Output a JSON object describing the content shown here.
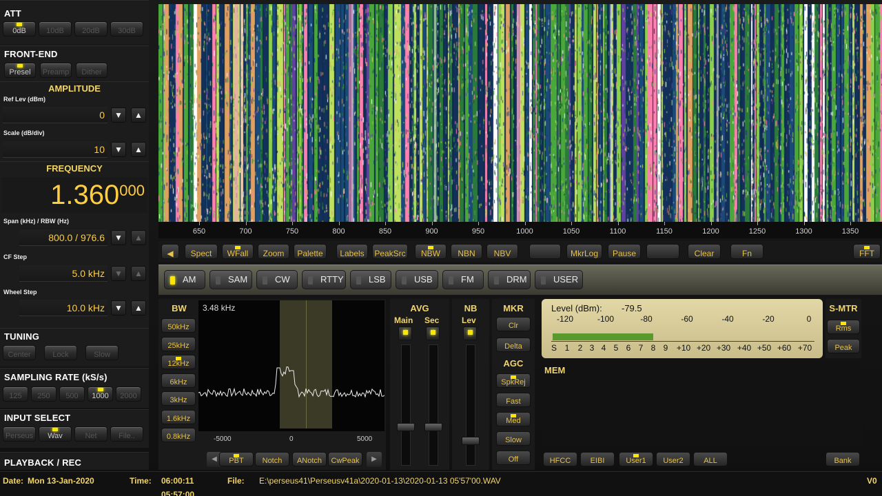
{
  "att": {
    "title": "ATT",
    "buttons": [
      "0dB",
      "10dB",
      "20dB",
      "30dB"
    ],
    "active": 0
  },
  "frontend": {
    "title": "FRONT-END",
    "buttons": [
      "Presel",
      "Preamp",
      "Dither"
    ],
    "active": 0
  },
  "amplitude": {
    "title": "AMPLITUDE",
    "ref_label": "Ref Lev (dBm)",
    "ref_value": "0",
    "scale_label": "Scale (dB/div)",
    "scale_value": "10"
  },
  "frequency": {
    "title": "FREQUENCY",
    "main": "1.360",
    "sub": "000",
    "span_label": "Span (kHz) / RBW (Hz)",
    "span_value": "800.0 / 976.6",
    "cfstep_label": "CF Step",
    "cfstep_value": "5.0 kHz",
    "wheel_label": "Wheel Step",
    "wheel_value": "10.0 kHz"
  },
  "tuning": {
    "title": "TUNING",
    "buttons": [
      "Center",
      "Lock",
      "Slow"
    ]
  },
  "sampling": {
    "title": "SAMPLING RATE (kS/s)",
    "buttons": [
      "125",
      "250",
      "500",
      "1000",
      "2000"
    ],
    "active": 3
  },
  "input": {
    "title": "INPUT SELECT",
    "buttons": [
      "Perseus",
      "Wav",
      "Net",
      "File.."
    ],
    "active": 1
  },
  "playback": {
    "title": "PLAYBACK / REC"
  },
  "freq_axis": [
    "650",
    "700",
    "750",
    "800",
    "850",
    "900",
    "950",
    "1000",
    "1050",
    "1100",
    "1150",
    "1200",
    "1250",
    "1300",
    "1350"
  ],
  "toolbar": {
    "buttons": [
      {
        "label": "◀",
        "led": false
      },
      {
        "label": "Spect",
        "led": false
      },
      {
        "label": "WFall",
        "led": true
      },
      {
        "label": "Zoom",
        "led": false
      },
      {
        "label": "Palette",
        "led": false
      },
      {
        "label": "Labels",
        "led": false
      },
      {
        "label": "PeakSrc",
        "led": false
      },
      {
        "label": "NBW",
        "led": true
      },
      {
        "label": "NBN",
        "led": false
      },
      {
        "label": "NBV",
        "led": false
      },
      {
        "label": "",
        "led": false
      },
      {
        "label": "MkrLog",
        "led": false
      },
      {
        "label": "Pause",
        "led": false
      },
      {
        "label": "",
        "led": false
      },
      {
        "label": "Clear",
        "led": false
      },
      {
        "label": "Fn",
        "led": false
      },
      {
        "label": "FFT",
        "led": true
      }
    ]
  },
  "modes": {
    "items": [
      "AM",
      "SAM",
      "CW",
      "RTTY",
      "LSB",
      "USB",
      "FM",
      "DRM",
      "USER"
    ],
    "active": 0
  },
  "bw": {
    "title": "BW",
    "value": "3.48 kHz",
    "buttons": [
      "50kHz",
      "25kHz",
      "12kHz",
      "6kHz",
      "3kHz",
      "1.6kHz",
      "0.8kHz"
    ],
    "active": 2,
    "axis": [
      "-5000",
      "0",
      "5000"
    ],
    "bottom": [
      "PBT",
      "Notch",
      "ANotch",
      "CwPeak"
    ]
  },
  "avg": {
    "title": "AVG",
    "main": "Main",
    "sec": "Sec"
  },
  "nb": {
    "title": "NB",
    "lev": "Lev"
  },
  "mkr": {
    "title": "MKR",
    "buttons": [
      "Clr",
      "Delta"
    ]
  },
  "agc": {
    "title": "AGC",
    "buttons": [
      "SpkRej",
      "Fast",
      "Med",
      "Slow",
      "Off"
    ],
    "active_led": [
      true,
      false,
      true,
      false,
      false
    ]
  },
  "smeter": {
    "level_label": "Level (dBm):",
    "level_value": "-79.5",
    "level_fraction": 0.52,
    "scale_top": [
      "-120",
      "-100",
      "-80",
      "-60",
      "-40",
      "-20",
      "0"
    ],
    "scale_bottom": [
      "S",
      "1",
      "2",
      "3",
      "4",
      "5",
      "6",
      "7",
      "8",
      "9",
      "+10",
      "+20",
      "+30",
      "+40",
      "+50",
      "+60",
      "+70"
    ],
    "title": "S-MTR",
    "buttons": [
      "Rms",
      "Peak"
    ]
  },
  "mem": {
    "title": "MEM",
    "buttons": [
      "HFCC",
      "EIBI",
      "User1",
      "User2",
      "ALL",
      "Bank"
    ]
  },
  "status": {
    "date_label": "Date:",
    "date_value": "Mon 13-Jan-2020",
    "time_label": "Time:",
    "time_value": "06:00:11",
    "time_value2": "05:57:00",
    "file_label": "File:",
    "file_value": "E:\\perseus41\\Perseusv41a\\2020-01-13\\2020-01-13 05'57'00.WAV",
    "version": "V0"
  },
  "colors": {
    "accent": "#f2d56a",
    "led": "#ffe600",
    "value": "#ffcd40"
  }
}
